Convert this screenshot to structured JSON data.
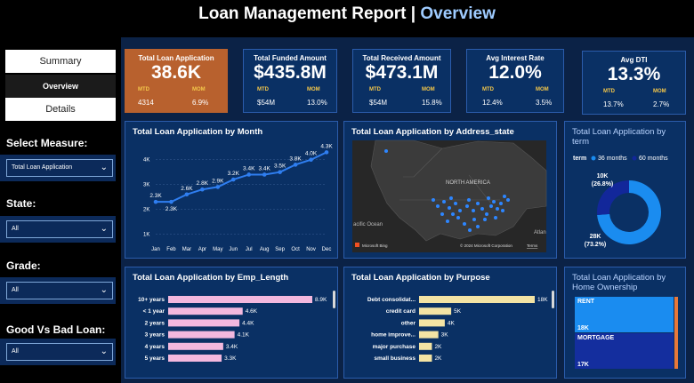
{
  "header": {
    "title": "Loan Management Report",
    "sep": " | ",
    "page": "Overview"
  },
  "nav": {
    "items": [
      "Summary",
      "Overview",
      "Details"
    ]
  },
  "filters": [
    {
      "label": "Select Measure:",
      "value": "Total Loan Application"
    },
    {
      "label": "State:",
      "value": "All"
    },
    {
      "label": "Grade:",
      "value": "All"
    },
    {
      "label": "Good Vs Bad Loan:",
      "value": "All"
    }
  ],
  "colors": {
    "kpi_active": "#b8612e",
    "line": "#2f7ef0",
    "emp_bar": "#f3b8de",
    "purpose_bar": "#f3e3a4",
    "pie_36": "#1a8cf0",
    "pie_60": "#12279a",
    "tree_rent": "#1a8cf0",
    "tree_mortgage": "#142e9e"
  },
  "kpis": [
    {
      "title": "Total Loan Application",
      "value": "38.6K",
      "mtd_label": "MTD",
      "mtd": "4314",
      "mom_label": "MOM",
      "mom": "6.9%"
    },
    {
      "title": "Total Funded Amount",
      "value": "$435.8M",
      "mtd_label": "MTD",
      "mtd": "$54M",
      "mom_label": "MOM",
      "mom": "13.0%"
    },
    {
      "title": "Total Received Amount",
      "value": "$473.1M",
      "mtd_label": "MTD",
      "mtd": "$54M",
      "mom_label": "MOM",
      "mom": "15.8%"
    },
    {
      "title": "Avg Interest Rate",
      "value": "12.0%",
      "mtd_label": "MTD",
      "mtd": "12.4%",
      "mom_label": "MOM",
      "mom": "3.5%"
    },
    {
      "title": "Avg DTI",
      "value": "13.3%",
      "mtd_label": "MTD",
      "mtd": "13.7%",
      "mom_label": "MOM",
      "mom": "2.7%"
    }
  ],
  "map": {
    "title": "Total Loan Application by Address_state",
    "region_label": "NORTH AMERICA",
    "ocean_left": "acific Ocean",
    "ocean_right": "Atlan",
    "bing": "Microsoft Bing",
    "copyright": "© 2024 Microsoft Corporation",
    "terms": "Terms"
  },
  "chart_data": [
    {
      "type": "line",
      "title": "Total Loan Application by Month",
      "categories": [
        "Jan",
        "Feb",
        "Mar",
        "Apr",
        "May",
        "Jun",
        "Jul",
        "Aug",
        "Sep",
        "Oct",
        "Nov",
        "Dec"
      ],
      "values": [
        2.3,
        2.3,
        2.6,
        2.8,
        2.9,
        3.2,
        3.4,
        3.4,
        3.5,
        3.8,
        4.0,
        4.3
      ],
      "labels": [
        "2.3K",
        "2.3K",
        "2.6K",
        "2.8K",
        "2.9K",
        "3.2K",
        "3.4K",
        "3.4K",
        "3.5K",
        "3.8K",
        "4.0K",
        "4.3K"
      ],
      "yticks": [
        "1K",
        "2K",
        "3K",
        "4K"
      ],
      "ylim": [
        0.8,
        4.6
      ]
    },
    {
      "type": "pie",
      "title": "Total Loan Application by term",
      "legend_title": "term",
      "series": [
        {
          "name": "36 months",
          "value": 28,
          "label": "28K",
          "pct": "(73.2%)"
        },
        {
          "name": "60 months",
          "value": 10,
          "label": "10K",
          "pct": "(26.8%)"
        }
      ]
    },
    {
      "type": "bar",
      "title": "Total Loan Application by Emp_Length",
      "categories": [
        "10+ years",
        "< 1 year",
        "2 years",
        "3 years",
        "4 years",
        "5 years"
      ],
      "values": [
        8.9,
        4.6,
        4.4,
        4.1,
        3.4,
        3.3
      ],
      "labels": [
        "8.9K",
        "4.6K",
        "4.4K",
        "4.1K",
        "3.4K",
        "3.3K"
      ]
    },
    {
      "type": "bar",
      "title": "Total Loan Application by Purpose",
      "categories": [
        "Debt consolidat...",
        "credit card",
        "other",
        "home improve...",
        "major purchase",
        "small business"
      ],
      "values": [
        18,
        5,
        4,
        3,
        2,
        2
      ],
      "labels": [
        "18K",
        "5K",
        "4K",
        "3K",
        "2K",
        "2K"
      ]
    },
    {
      "type": "heatmap",
      "title": "Total Loan Application by Home Ownership",
      "categories": [
        "RENT",
        "MORTGAGE"
      ],
      "labels": [
        "18K",
        "17K"
      ],
      "values": [
        18,
        17
      ]
    }
  ]
}
